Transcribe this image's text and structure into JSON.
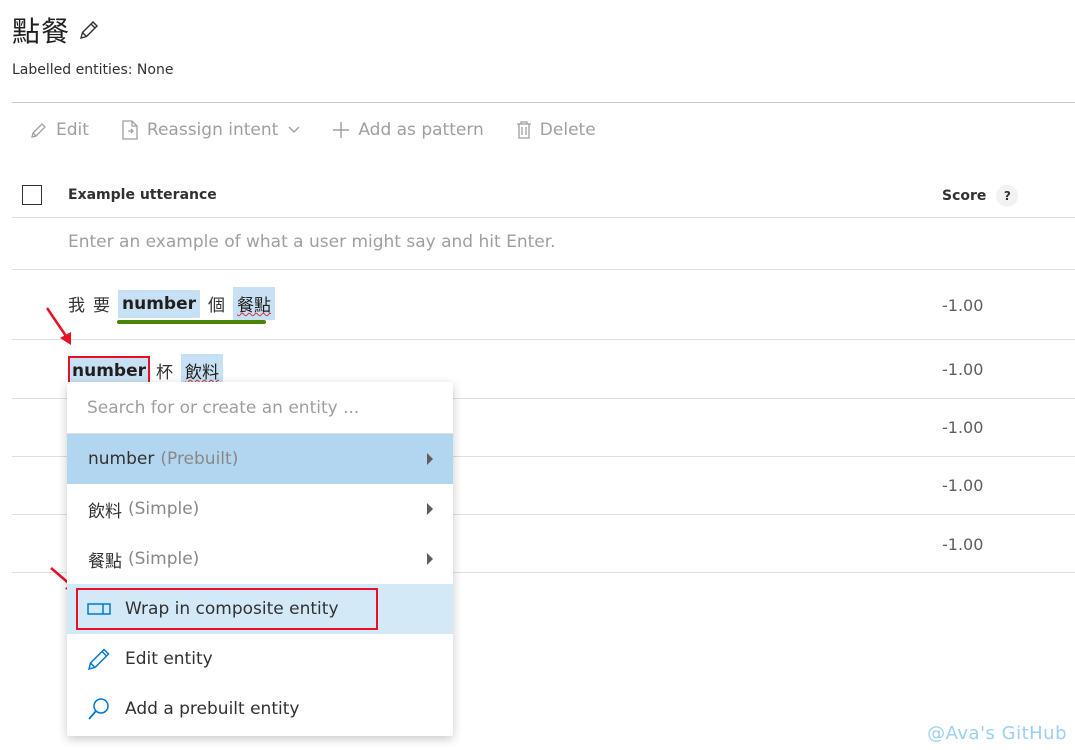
{
  "page": {
    "title": "點餐",
    "labelled_entities": "Labelled entities: None"
  },
  "toolbar": {
    "edit": "Edit",
    "reassign": "Reassign intent",
    "add_pattern": "Add as pattern",
    "delete": "Delete"
  },
  "table": {
    "col_utterance": "Example utterance",
    "col_score": "Score",
    "help": "?",
    "placeholder": "Enter an example of what a user might say and hit Enter.",
    "rows": [
      {
        "tokens": [
          "我",
          "要",
          "number",
          "個",
          "餐點"
        ],
        "score": "-1.00"
      },
      {
        "tokens": [
          "number",
          "杯",
          "飲料"
        ],
        "score": "-1.00"
      },
      {
        "score": "-1.00"
      },
      {
        "score": "-1.00"
      },
      {
        "score": "-1.00"
      }
    ]
  },
  "menu": {
    "search_placeholder": "Search for or create an entity ...",
    "entities": [
      {
        "name": "number",
        "type": "(Prebuilt)"
      },
      {
        "name": "飲料",
        "type": "(Simple)"
      },
      {
        "name": "餐點",
        "type": "(Simple)"
      }
    ],
    "actions": {
      "wrap": "Wrap in composite entity",
      "edit": "Edit entity",
      "add_prebuilt": "Add a prebuilt entity"
    }
  },
  "watermark": "@Ava's GitHub",
  "colors": {
    "entity_bg": "#c7e0f4",
    "accent": "#0078d4",
    "annotation_red": "#e81123",
    "composite_green": "#498205"
  }
}
